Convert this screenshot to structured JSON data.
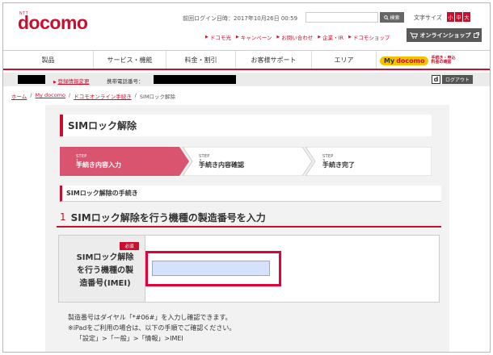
{
  "header": {
    "logo_ntt": "NTT",
    "logo_word": "docomo",
    "last_login_label": "前回ログイン日時：",
    "last_login_value": "2017年10月26日 00:59",
    "search_button": "検索",
    "search_icon": "search-icon",
    "font_size_label": "文字サイズ",
    "font_sizes": [
      "小",
      "中",
      "大"
    ],
    "top_links": [
      "ドコモ光",
      "キャンペーン",
      "お問い合わせ",
      "企業・IR",
      "ドコモショップ"
    ],
    "online_shop": "オンラインショップ",
    "cart_icon": "cart-icon"
  },
  "nav": {
    "items": [
      "製品",
      "サービス・機能",
      "料金・割引",
      "お客様サポート",
      "エリア"
    ],
    "mydocomo_my": "My",
    "mydocomo_word": "docomo",
    "mydocomo_sub1": "手続き・申込",
    "mydocomo_sub2": "料金の確認"
  },
  "userbar": {
    "reg_change": "登録情報変更",
    "phone_label": "携帯電話番号：",
    "d_icon": "d",
    "logout": "ログアウト"
  },
  "breadcrumb": {
    "items": [
      "ホーム",
      "My docomo",
      "ドコモオンライン手続き",
      "SIMロック解除"
    ],
    "separator": "/"
  },
  "page": {
    "title": "SIMロック解除",
    "steps": [
      {
        "num": "STEP 1",
        "label": "手続き内容入力",
        "active": true
      },
      {
        "num": "STEP 2",
        "label": "手続き内容確認",
        "active": false
      },
      {
        "num": "STEP 3",
        "label": "手続き完了",
        "active": false
      }
    ],
    "section_title": "SIMロック解除の手続き",
    "question_num": "1",
    "question_title": "SIMロック解除を行う機種の製造番号を入力",
    "required": "必須",
    "field_label_lines": [
      "SIMロック解除",
      "を行う機種の製",
      "造番号(IMEI)"
    ],
    "imei_value": "",
    "notes": [
      "製造番号はダイヤル「*#06#」を入力し確認できます。",
      "※iPadをご利用の場合は、以下の手順でご確認ください。",
      "「設定」>「一般」>「情報」>IMEI"
    ]
  },
  "colors": {
    "brand_red": "#c8102e",
    "step_active": "#d9546e",
    "highlight": "#e60039"
  }
}
